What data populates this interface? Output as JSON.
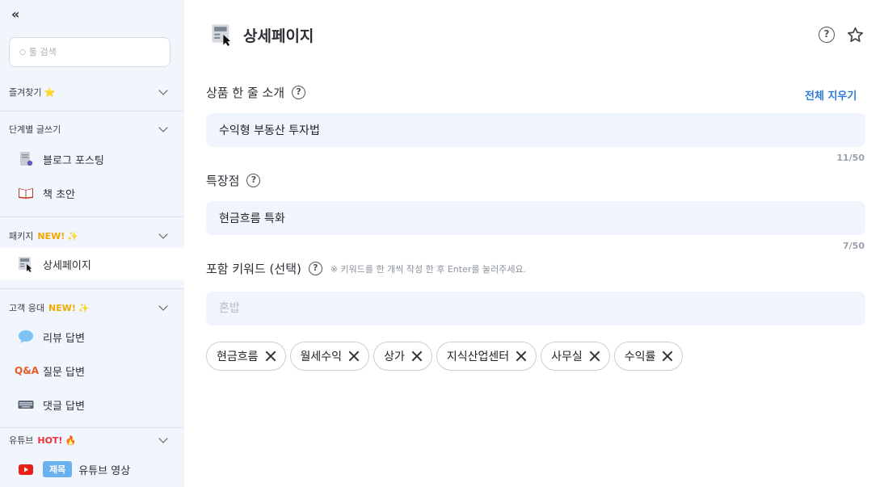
{
  "sidebar": {
    "collapse_label": "«",
    "search_placeholder": "툴 검색",
    "sections": {
      "favorites": {
        "title": "즐겨찾기",
        "emoji": "⭐"
      },
      "step_writing": {
        "title": "단계별 글쓰기"
      },
      "package": {
        "title": "패키지",
        "badge": "NEW!",
        "emoji": "✨"
      },
      "customer": {
        "title": "고객 응대",
        "badge": "NEW!",
        "emoji": "✨"
      },
      "youtube": {
        "title": "유튜브",
        "badge": "HOT!",
        "emoji": "🔥"
      }
    },
    "items": {
      "blog": "블로그 포스팅",
      "book": "책 초안",
      "detail": "상세페이지",
      "review": "리뷰 답변",
      "qa_icon": "Q&A",
      "question": "질문 답변",
      "comment": "댓글 답변",
      "subject_tag": "제목",
      "youtube_video": "유튜브 영상"
    }
  },
  "header": {
    "title": "상세페이지",
    "help": "?"
  },
  "form": {
    "intro": {
      "label": "상품 한 줄 소개",
      "value": "수익형 부동산 투자법",
      "counter": "11/50",
      "clear_all": "전체 지우기"
    },
    "feature": {
      "label": "특장점",
      "value": "현금흐름 특화",
      "counter": "7/50"
    },
    "keywords": {
      "label": "포함 키워드 (선택)",
      "hint": "※ 키워드를 한 개씩 작성 한 후 Enter를 눌러주세요.",
      "placeholder": "혼밥",
      "chips": [
        "현금흐름",
        "월세수익",
        "상가",
        "지식산업센터",
        "사무실",
        "수익률"
      ]
    }
  },
  "colors": {
    "accent": "#2d7ad6",
    "sidebar_bg": "#f1f5fc",
    "field_bg": "#eff4fd",
    "new_badge": "#f2a900",
    "hot_badge": "#e8313b"
  }
}
